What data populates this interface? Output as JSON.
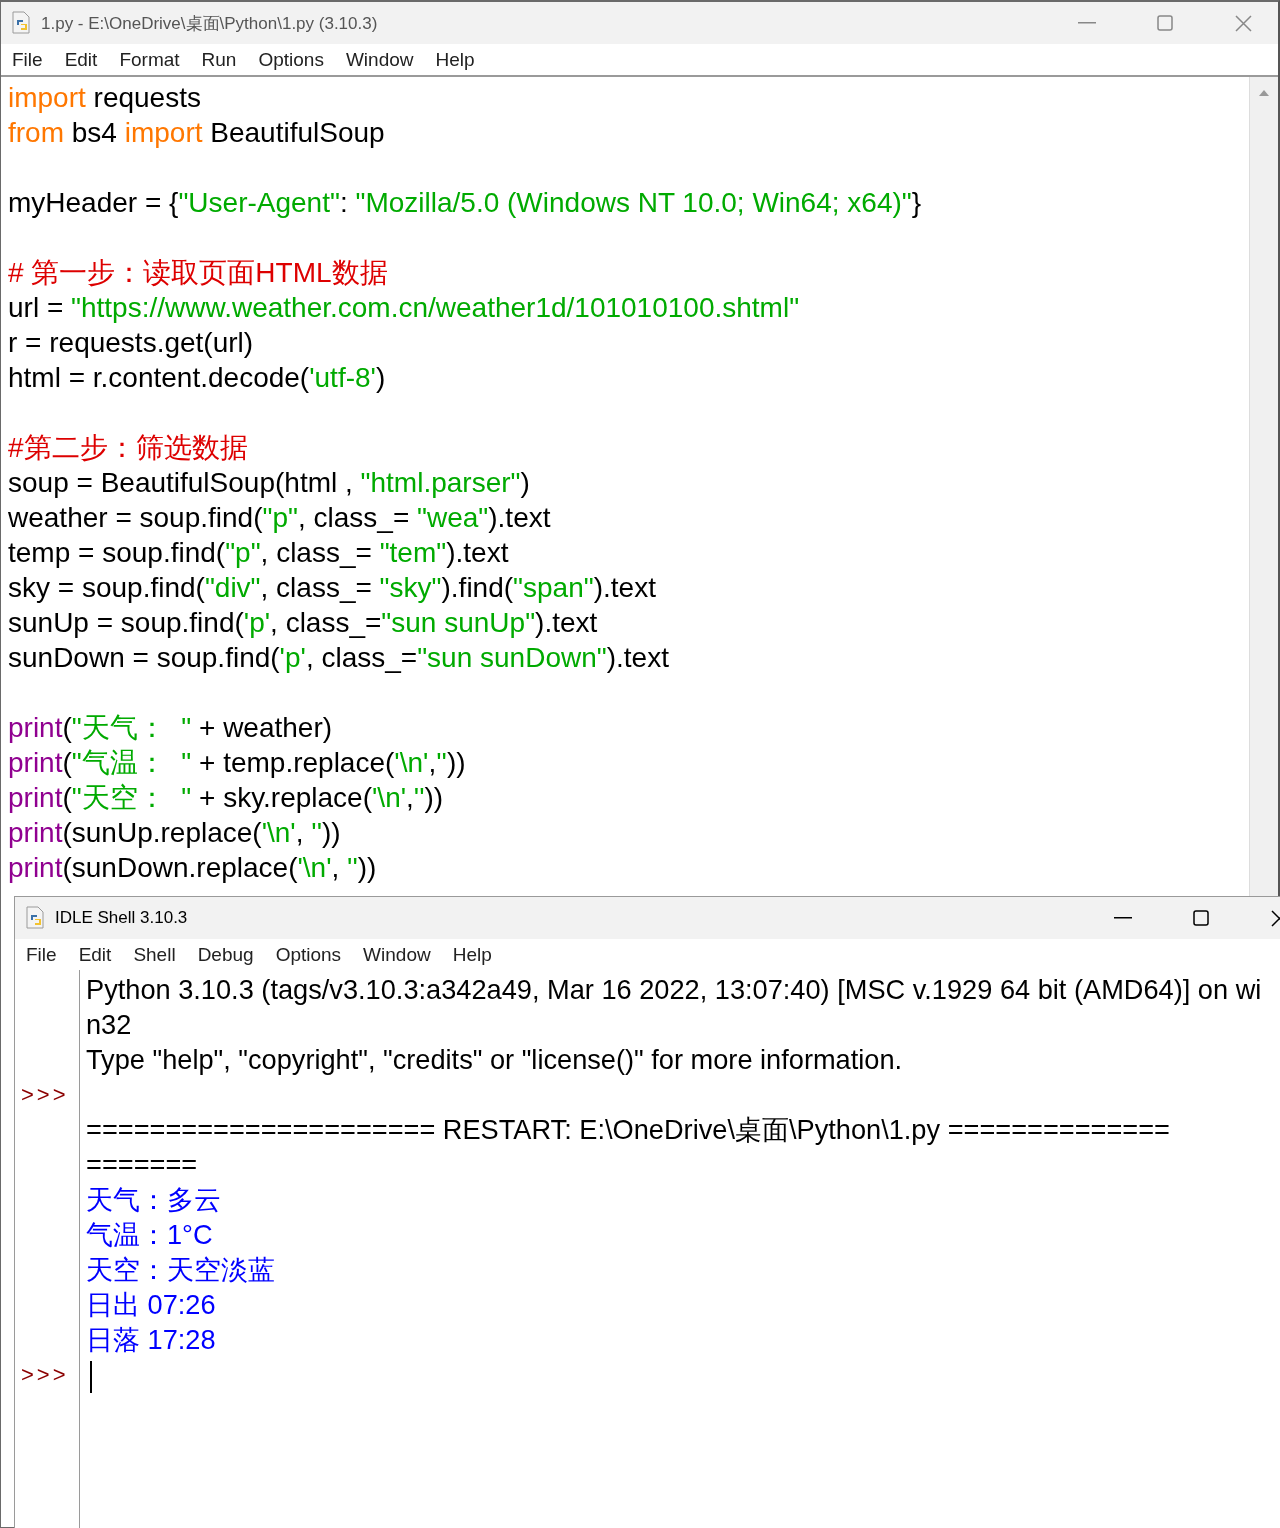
{
  "editor_window": {
    "title": "1.py - E:\\OneDrive\\桌面\\Python\\1.py (3.10.3)",
    "menu": [
      "File",
      "Edit",
      "Format",
      "Run",
      "Options",
      "Window",
      "Help"
    ],
    "code_lines": [
      [
        {
          "kind": "keyword",
          "text": "import"
        },
        {
          "kind": "plain",
          "text": " requests"
        }
      ],
      [
        {
          "kind": "keyword",
          "text": "from"
        },
        {
          "kind": "plain",
          "text": " bs4 "
        },
        {
          "kind": "keyword",
          "text": "import"
        },
        {
          "kind": "plain",
          "text": " BeautifulSoup"
        }
      ],
      [
        {
          "kind": "blank"
        }
      ],
      [
        {
          "kind": "plain",
          "text": "myHeader = {"
        },
        {
          "kind": "string",
          "text": "\"User-Agent\""
        },
        {
          "kind": "plain",
          "text": ": "
        },
        {
          "kind": "string",
          "text": "\"Mozilla/5.0 (Windows NT 10.0; Win64; x64)\""
        },
        {
          "kind": "plain",
          "text": "}"
        }
      ],
      [
        {
          "kind": "blank"
        }
      ],
      [
        {
          "kind": "comment",
          "text": "# 第一步：读取页面HTML数据"
        }
      ],
      [
        {
          "kind": "plain",
          "text": "url = "
        },
        {
          "kind": "string",
          "text": "\"https://www.weather.com.cn/weather1d/101010100.shtml\""
        }
      ],
      [
        {
          "kind": "plain",
          "text": "r = requests.get(url)"
        }
      ],
      [
        {
          "kind": "plain",
          "text": "html = r.content.decode("
        },
        {
          "kind": "string",
          "text": "'utf-8'"
        },
        {
          "kind": "plain",
          "text": ")"
        }
      ],
      [
        {
          "kind": "blank"
        }
      ],
      [
        {
          "kind": "comment",
          "text": "#第二步：筛选数据"
        }
      ],
      [
        {
          "kind": "plain",
          "text": "soup = BeautifulSoup(html , "
        },
        {
          "kind": "string",
          "text": "\"html.parser\""
        },
        {
          "kind": "plain",
          "text": ")"
        }
      ],
      [
        {
          "kind": "plain",
          "text": "weather = soup.find("
        },
        {
          "kind": "string",
          "text": "\"p\""
        },
        {
          "kind": "plain",
          "text": ", class_= "
        },
        {
          "kind": "string",
          "text": "\"wea\""
        },
        {
          "kind": "plain",
          "text": ").text"
        }
      ],
      [
        {
          "kind": "plain",
          "text": "temp = soup.find("
        },
        {
          "kind": "string",
          "text": "\"p\""
        },
        {
          "kind": "plain",
          "text": ", class_= "
        },
        {
          "kind": "string",
          "text": "\"tem\""
        },
        {
          "kind": "plain",
          "text": ").text"
        }
      ],
      [
        {
          "kind": "plain",
          "text": "sky = soup.find("
        },
        {
          "kind": "string",
          "text": "\"div\""
        },
        {
          "kind": "plain",
          "text": ", class_= "
        },
        {
          "kind": "string",
          "text": "\"sky\""
        },
        {
          "kind": "plain",
          "text": ").find("
        },
        {
          "kind": "string",
          "text": "\"span\""
        },
        {
          "kind": "plain",
          "text": ").text"
        }
      ],
      [
        {
          "kind": "plain",
          "text": "sunUp = soup.find("
        },
        {
          "kind": "string",
          "text": "'p'"
        },
        {
          "kind": "plain",
          "text": ", class_="
        },
        {
          "kind": "string",
          "text": "\"sun sunUp\""
        },
        {
          "kind": "plain",
          "text": ").text"
        }
      ],
      [
        {
          "kind": "plain",
          "text": "sunDown = soup.find("
        },
        {
          "kind": "string",
          "text": "'p'"
        },
        {
          "kind": "plain",
          "text": ", class_="
        },
        {
          "kind": "string",
          "text": "\"sun sunDown\""
        },
        {
          "kind": "plain",
          "text": ").text"
        }
      ],
      [
        {
          "kind": "blank"
        }
      ],
      [
        {
          "kind": "builtin",
          "text": "print"
        },
        {
          "kind": "plain",
          "text": "("
        },
        {
          "kind": "string",
          "text": "\"天气：  \""
        },
        {
          "kind": "plain",
          "text": " + weather)"
        }
      ],
      [
        {
          "kind": "builtin",
          "text": "print"
        },
        {
          "kind": "plain",
          "text": "("
        },
        {
          "kind": "string",
          "text": "\"气温：  \""
        },
        {
          "kind": "plain",
          "text": " + temp.replace("
        },
        {
          "kind": "string",
          "text": "'\\n'"
        },
        {
          "kind": "plain",
          "text": ","
        },
        {
          "kind": "string",
          "text": "''"
        },
        {
          "kind": "plain",
          "text": "))"
        }
      ],
      [
        {
          "kind": "builtin",
          "text": "print"
        },
        {
          "kind": "plain",
          "text": "("
        },
        {
          "kind": "string",
          "text": "\"天空：  \""
        },
        {
          "kind": "plain",
          "text": " + sky.replace("
        },
        {
          "kind": "string",
          "text": "'\\n'"
        },
        {
          "kind": "plain",
          "text": ","
        },
        {
          "kind": "string",
          "text": "''"
        },
        {
          "kind": "plain",
          "text": "))"
        }
      ],
      [
        {
          "kind": "builtin",
          "text": "print"
        },
        {
          "kind": "plain",
          "text": "(sunUp.replace("
        },
        {
          "kind": "string",
          "text": "'\\n'"
        },
        {
          "kind": "plain",
          "text": ", "
        },
        {
          "kind": "string",
          "text": "''"
        },
        {
          "kind": "plain",
          "text": "))"
        }
      ],
      [
        {
          "kind": "builtin",
          "text": "print"
        },
        {
          "kind": "plain",
          "text": "(sunDown.replace("
        },
        {
          "kind": "string",
          "text": "'\\n'"
        },
        {
          "kind": "plain",
          "text": ", "
        },
        {
          "kind": "string",
          "text": "''"
        },
        {
          "kind": "plain",
          "text": "))"
        }
      ]
    ]
  },
  "shell_window": {
    "title": "IDLE Shell 3.10.3",
    "menu": [
      "File",
      "Edit",
      "Shell",
      "Debug",
      "Options",
      "Window",
      "Help"
    ],
    "lines": [
      {
        "kind": "output",
        "text": "Python 3.10.3 (tags/v3.10.3:a342a49, Mar 16 2022, 13:07:40) [MSC v.1929 64 bit (AMD64)] on wi"
      },
      {
        "kind": "output",
        "text": "n32"
      },
      {
        "kind": "output",
        "text": "Type \"help\", \"copyright\", \"credits\" or \"license()\" for more information."
      },
      {
        "kind": "prompt",
        "prompt": ">>>"
      },
      {
        "kind": "output",
        "text": "====================== RESTART: E:\\OneDrive\\桌面\\Python\\1.py =============="
      },
      {
        "kind": "output",
        "text": "======="
      },
      {
        "kind": "stdout",
        "text": "天气：多云"
      },
      {
        "kind": "stdout",
        "text": "气温：1°C"
      },
      {
        "kind": "stdout",
        "text": "天空：天空淡蓝"
      },
      {
        "kind": "stdout",
        "text": "日出 07:26"
      },
      {
        "kind": "stdout",
        "text": "日落 17:28"
      },
      {
        "kind": "prompt",
        "prompt": ">>>",
        "cursor": true
      }
    ]
  }
}
